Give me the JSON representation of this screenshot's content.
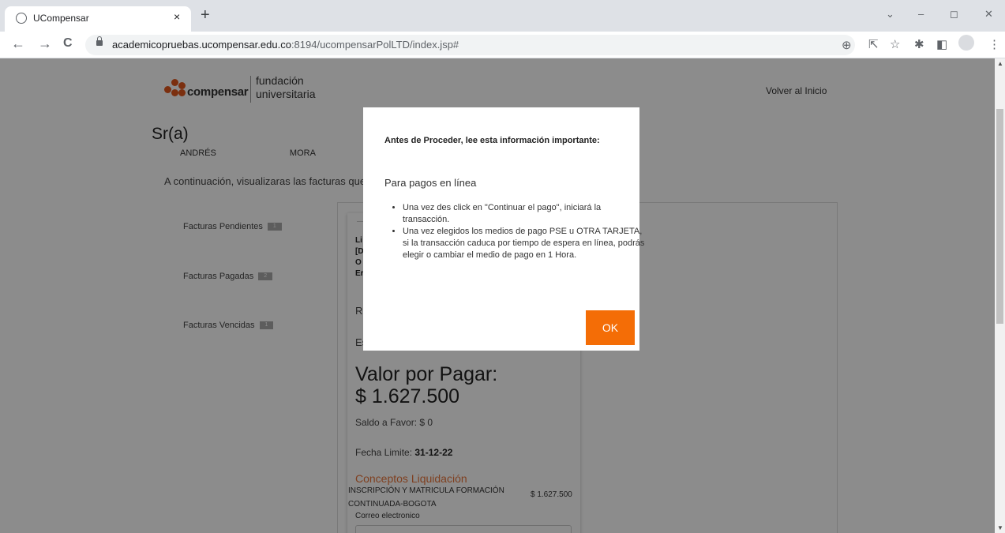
{
  "browser": {
    "tab_title": "UCompensar",
    "tab_close": "×",
    "new_tab": "+",
    "url_host": "academicopruebas.ucompensar.edu.co",
    "url_rest": ":8194/ucompensarPolLTD/index.jsp#",
    "controls": {
      "minimize": "–",
      "restore": "◻",
      "close": "✕",
      "dropdown": "⌄"
    },
    "icons": {
      "back": "←",
      "forward": "→",
      "reload": "C",
      "zoom": "⊕",
      "share": "⇱",
      "star": "☆",
      "extensions": "✱",
      "sidepanel": "◧",
      "menu": "⋮"
    }
  },
  "header": {
    "logo_word": "compensar",
    "logo_line1": "fundación",
    "logo_line2": "universitaria",
    "volver": "Volver al Inicio"
  },
  "user": {
    "salutation": "Sr(a)",
    "first_name": "ANDRÉS",
    "last_name": "MORA"
  },
  "intro": "A continuación, visualizaras las facturas que",
  "sidebar": {
    "items": [
      {
        "label": "Facturas Pendientes",
        "count": "1"
      },
      {
        "label": "Facturas Pagadas",
        "count": "2"
      },
      {
        "label": "Facturas Vencidas",
        "count": "1"
      }
    ]
  },
  "card": {
    "lines": [
      "Li",
      "[D",
      "O",
      "Er"
    ],
    "r_text": "Re",
    "e_text": "Es",
    "valor_label": "Valor por Pagar:",
    "valor_amount": "$ 1.627.500",
    "saldo": "Saldo a Favor: $ 0",
    "fecha_label": "Fecha Limite:",
    "fecha_value": "31-12-22",
    "conceptos_title": "Conceptos Liquidación",
    "concept_name": "INSCRIPCIÓN Y MATRICULA FORMACIÓN CONTINUADA-BOGOTA",
    "concept_value": "$ 1.627.500",
    "correo_label": "Correo electronico"
  },
  "modal": {
    "title": "Antes de Proceder, lee esta información importante:",
    "subtitle": "Para pagos en línea",
    "bullets": [
      "Una vez des click en \"Continuar el pago\", iniciará la transacción.",
      "Una vez elegidos los medios de pago PSE u OTRA TARJETA, si la transacción caduca por tiempo de espera en línea, podrás elegir o cambiar el medio de pago en 1 Hora."
    ],
    "ok_label": "OK"
  }
}
